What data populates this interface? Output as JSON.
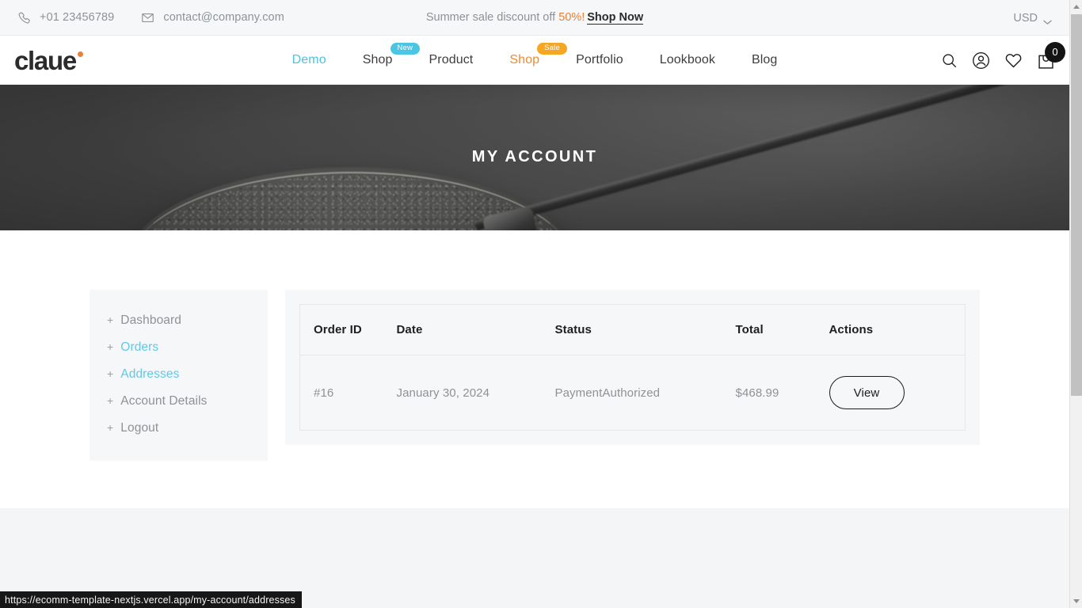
{
  "topbar": {
    "phone": "+01 23456789",
    "email": "contact@company.com",
    "promo_prefix": "Summer sale discount off ",
    "promo_highlight": "50%!",
    "promo_link": "Shop Now",
    "currency": "USD"
  },
  "header": {
    "logo": "claue",
    "nav": [
      {
        "label": "Demo",
        "style": "accent-blue",
        "badge": null
      },
      {
        "label": "Shop",
        "style": "",
        "badge": "New",
        "badge_type": "new"
      },
      {
        "label": "Product",
        "style": "",
        "badge": null
      },
      {
        "label": "Shop",
        "style": "accent-orange",
        "badge": "Sale",
        "badge_type": "sale"
      },
      {
        "label": "Portfolio",
        "style": "",
        "badge": null
      },
      {
        "label": "Lookbook",
        "style": "",
        "badge": null
      },
      {
        "label": "Blog",
        "style": "",
        "badge": null
      }
    ],
    "icons": [
      "search-icon",
      "account-icon",
      "wishlist-heart-icon",
      "cart-bag-icon"
    ],
    "cart_count": "0"
  },
  "hero": {
    "title": "MY ACCOUNT"
  },
  "sidebar": {
    "items": [
      {
        "label": "Dashboard",
        "state": ""
      },
      {
        "label": "Orders",
        "state": "active"
      },
      {
        "label": "Addresses",
        "state": "hovered"
      },
      {
        "label": "Account Details",
        "state": ""
      },
      {
        "label": "Logout",
        "state": ""
      }
    ],
    "prefix": "+"
  },
  "orders": {
    "columns": [
      "Order ID",
      "Date",
      "Status",
      "Total",
      "Actions"
    ],
    "rows": [
      {
        "order_id": "#16",
        "date": "January 30, 2024",
        "status": "PaymentAuthorized",
        "total": "$468.99",
        "action_label": "View"
      }
    ]
  },
  "statusbar": {
    "url": "https://ecomm-template-nextjs.vercel.app/my-account/addresses"
  },
  "colors": {
    "accent_blue": "#4dc3e0",
    "accent_orange": "#f08a2e",
    "promo_orange": "#e8803a",
    "badge_new": "#4ac6e4",
    "badge_sale": "#f5a623",
    "panel_bg": "#f6f7f9",
    "text_muted": "#8e9296",
    "text_dark": "#1f1f1f"
  }
}
